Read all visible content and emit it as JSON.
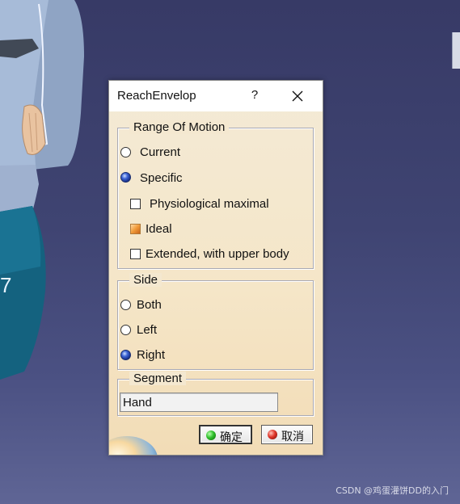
{
  "dialog": {
    "title": "ReachEnvelop",
    "help_label": "?",
    "range_of_motion": {
      "label": "Range Of Motion",
      "radios": [
        {
          "label": "Current",
          "checked": false
        },
        {
          "label": "Specific",
          "checked": true
        }
      ],
      "checkboxes": [
        {
          "label": "Physiological maximal",
          "checked": false
        },
        {
          "label": "Ideal",
          "checked": true
        },
        {
          "label": "Extended, with upper body",
          "checked": false
        }
      ]
    },
    "side": {
      "label": "Side",
      "radios": [
        {
          "label": "Both",
          "checked": false
        },
        {
          "label": "Left",
          "checked": false
        },
        {
          "label": "Right",
          "checked": true
        }
      ]
    },
    "segment": {
      "label": "Segment",
      "value": "Hand"
    },
    "buttons": {
      "ok_label": "确定",
      "cancel_label": "取消"
    }
  },
  "viewport": {
    "mannequin_label": "7"
  },
  "watermark": "CSDN @鸡蛋灌饼DD的入门"
}
